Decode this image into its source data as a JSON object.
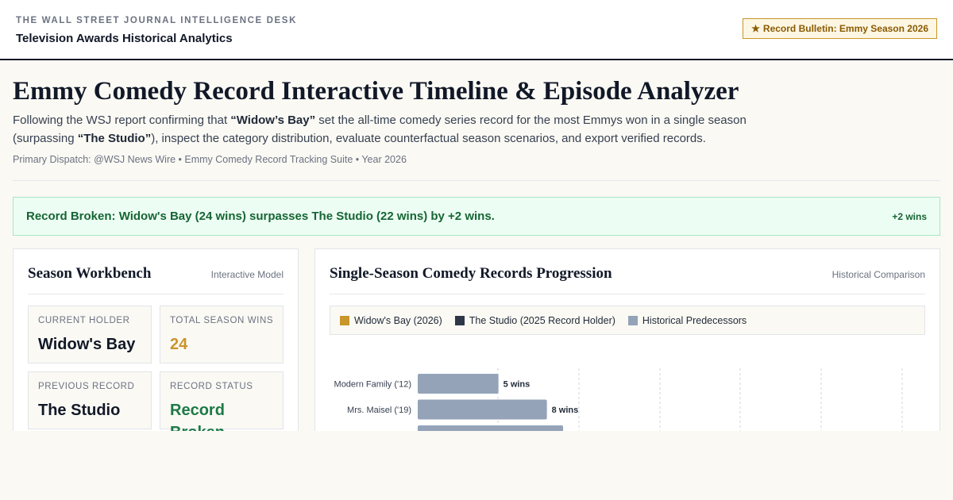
{
  "header": {
    "kicker": "THE WALL STREET JOURNAL INTELLIGENCE DESK",
    "subtitle": "Television Awards Historical Analytics",
    "bulletin": "Record Bulletin: Emmy Season 2026",
    "bulletin_icon": "star-icon"
  },
  "intro": {
    "title": "Emmy Comedy Record Interactive Timeline & Episode Analyzer",
    "lead_1": "Following the WSJ report confirming that ",
    "lead_show_1": "“Widow’s Bay”",
    "lead_2": " set the all-time comedy series record for the most Emmys won in a single season (surpassing ",
    "lead_show_2": "“The Studio”",
    "lead_3": "), inspect the category distribution, evaluate counterfactual season scenarios, and export verified records.",
    "dispatch": "Primary Dispatch: @WSJ News Wire • Emmy Comedy Record Tracking Suite • Year 2026"
  },
  "banner": {
    "message": "Record Broken: Widow's Bay (24 wins) surpasses The Studio (22 wins) by +2 wins.",
    "delta": "+2 wins"
  },
  "workbench": {
    "title": "Season Workbench",
    "tag": "Interactive Model",
    "stats": [
      {
        "label": "CURRENT HOLDER",
        "value": "Widow's Bay"
      },
      {
        "label": "TOTAL SEASON WINS",
        "value": "24"
      },
      {
        "label": "PREVIOUS RECORD",
        "value": "The Studio"
      },
      {
        "label": "RECORD STATUS",
        "value": "Record Broken"
      }
    ]
  },
  "records": {
    "title": "Single-Season Comedy Records Progression",
    "tag": "Historical Comparison"
  },
  "colors": {
    "gold": "#c9962a",
    "navy": "#2d3748",
    "slate": "#94a3b8",
    "green": "#1d7a46"
  },
  "chart_data": {
    "type": "bar",
    "orientation": "horizontal",
    "categories": [
      "Modern Family ('12)",
      "Mrs. Maisel ('19)"
    ],
    "values": [
      5,
      8
    ],
    "value_suffix": " wins",
    "series_legend": [
      {
        "name": "Widow's Bay (2026)",
        "color": "#c9962a"
      },
      {
        "name": "The Studio (2025 Record Holder)",
        "color": "#2d3748"
      },
      {
        "name": "Historical Predecessors",
        "color": "#94a3b8"
      }
    ],
    "xlim": [
      0,
      30
    ],
    "grid": true
  }
}
